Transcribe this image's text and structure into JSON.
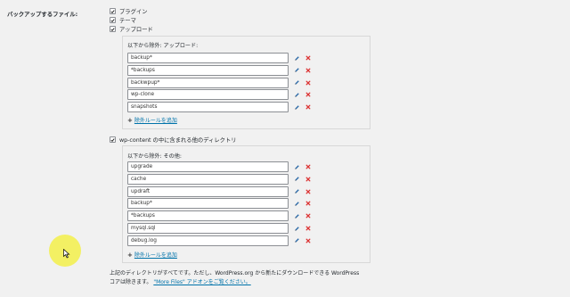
{
  "section": {
    "label": "バックアップするファイル:"
  },
  "options": [
    {
      "label": "プラグイン",
      "checked": true
    },
    {
      "label": "テーマ",
      "checked": true
    },
    {
      "label": "アップロード",
      "checked": true
    }
  ],
  "uploads_box": {
    "title": "以下から除外: アップロード:",
    "items": [
      "backup*",
      "*backups",
      "backwpup*",
      "wp-clone",
      "snapshots"
    ],
    "add_label": "除外ルールを追加"
  },
  "other": {
    "label": "wp-content の中に含まれる他のディレクトリ",
    "checked": true
  },
  "other_box": {
    "title": "以下から除外: その他:",
    "items": [
      "upgrade",
      "cache",
      "updraft",
      "backup*",
      "*backups",
      "mysql.sql",
      "debug.log"
    ],
    "add_label": "除外ルールを追加"
  },
  "note": {
    "text_line1": "上記のディレクトリがすべてです。ただし、WordPress.org から新たにダウンロードできる WordPress",
    "text_line2": "コアは除きます。",
    "link": "\"More Files\" アドオンをご覧ください。"
  },
  "colors": {
    "accent": "#0073aa",
    "delete": "#dc3232",
    "halo": "#f3f04a"
  },
  "icons": {
    "edit": "pencil-icon",
    "delete": "delete-x-icon",
    "add": "plus-icon"
  }
}
